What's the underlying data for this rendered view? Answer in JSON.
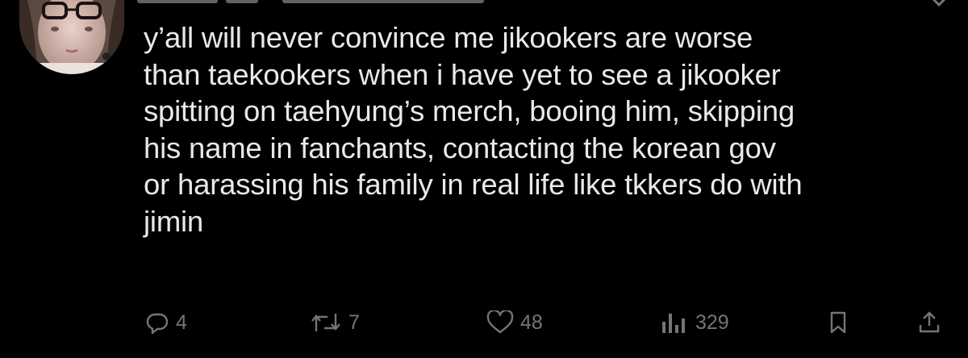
{
  "tweet": {
    "text": "y’all will never convince me jikookers are worse than taekookers when i have yet to see a jikooker spitting on taehyung’s merch, booing him, skipping his name in fanchants, contacting the korean gov or harassing his family in real life like tkkers do with jimin",
    "lines": [
      "y’all will never convince me jikookers are worse",
      "than taekookers when i have yet to see a jikooker",
      "spitting on taehyung’s merch, booing him, skipping",
      "his name in fanchants, contacting the korean gov",
      "or harassing his family in real life like tkkers do with",
      "jimin"
    ]
  },
  "actions": {
    "reply": {
      "icon": "reply-icon",
      "count": "4"
    },
    "retweet": {
      "icon": "retweet-icon",
      "count": "7"
    },
    "like": {
      "icon": "heart-icon",
      "count": "48"
    },
    "views": {
      "icon": "views-chart-icon",
      "count": "329"
    },
    "bookmark": {
      "icon": "bookmark-icon"
    },
    "share": {
      "icon": "share-icon"
    }
  },
  "colors": {
    "background": "#000000",
    "text": "#e7e9ea",
    "muted": "#71767b"
  }
}
